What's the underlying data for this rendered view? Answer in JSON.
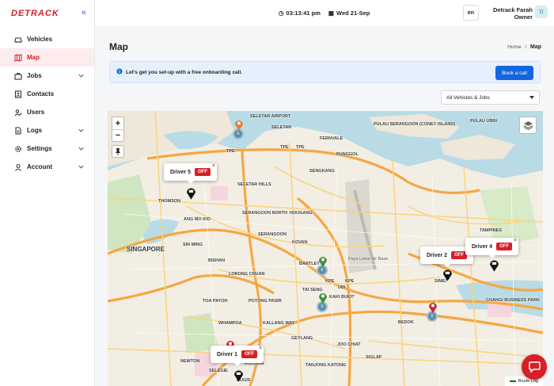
{
  "app": {
    "logo": "DETRACK"
  },
  "sidebar": {
    "items": [
      {
        "label": "Vehicles",
        "icon": "car-icon",
        "active": false,
        "has_submenu": false
      },
      {
        "label": "Map",
        "icon": "map-icon",
        "active": true,
        "has_submenu": false
      },
      {
        "label": "Jobs",
        "icon": "briefcase-icon",
        "active": false,
        "has_submenu": true
      },
      {
        "label": "Contacts",
        "icon": "contacts-icon",
        "active": false,
        "has_submenu": false
      },
      {
        "label": "Users",
        "icon": "users-icon",
        "active": false,
        "has_submenu": false
      },
      {
        "label": "Logs",
        "icon": "log-icon",
        "active": false,
        "has_submenu": true
      },
      {
        "label": "Settings",
        "icon": "gear-icon",
        "active": false,
        "has_submenu": true
      },
      {
        "label": "Account",
        "icon": "account-icon",
        "active": false,
        "has_submenu": true
      }
    ]
  },
  "header": {
    "time": "03:13:41 pm",
    "date": "Wed 21-Sep",
    "language": "en",
    "user_name": "Detrack Farah",
    "user_role": "Owner",
    "avatar_initial": "D"
  },
  "page": {
    "title": "Map",
    "breadcrumb_home": "Home",
    "breadcrumb_sep": "/",
    "breadcrumb_current": "Map"
  },
  "banner": {
    "text": "Let's get you set-up with a free onboarding call.",
    "button": "Book a call"
  },
  "filter": {
    "selected": "All Vehicles & Jobs"
  },
  "map": {
    "zoom_in": "+",
    "zoom_out": "−",
    "route_log": "Route Log",
    "labels": {
      "seletar_airport": "SELETAR AIRPORT",
      "seletar": "SELETAR",
      "fernvale": "FERNVALE",
      "punggol": "PUNGGOL",
      "tpe1": "TPE",
      "tpe2": "TPE",
      "tpe3": "TPE",
      "sengkang": "SENGKANG",
      "seletar_hills": "SELETAR HILLS",
      "thomson": "THOMSON",
      "ang_mo_kio": "ANG MO KIO",
      "serangoon_north": "SERANGOON NORTH",
      "hougang": "HOUGANG",
      "serangoon": "SERANGOON",
      "singapore": "SINGAPORE",
      "sin_ming": "SIN MING",
      "kovan": "KOVAN",
      "bishan": "BISHAN",
      "bartley": "BARTLEY",
      "paya_lebar_air_base": "Paya Lebar Air Base",
      "pulau_serangoon": "PULAU SERANGOON (CONEY ISLAND)",
      "pulau_ubin": "PULAU UBIN",
      "lorong_chuan": "LORONG CHUAN",
      "toa_payoh": "TOA PAYOH",
      "potong_pasir": "POTONG PASIR",
      "tai_seng": "TAI SENG",
      "ubi": "UBI",
      "kaki_bukit": "KAKI BUKIT",
      "kpe1": "KPE",
      "kpe2": "KPE",
      "changi_business_park": "CHANGI BUSINESS PARK",
      "whampoa": "WHAMPOA",
      "kallang_way": "KALLANG WAY",
      "bedok": "BEDOK",
      "geylang": "GEYLANG",
      "joo_chiat": "JOO CHIAT",
      "newton": "NEWTON",
      "rochor": "ROCHOR",
      "bugis": "BUGIS",
      "selegie": "SELEGIE",
      "tanjong_katong": "TANJONG KATONG",
      "siglap": "SIGLAP",
      "tampines": "TAMPINES",
      "simei": "SIMEI"
    },
    "drivers": [
      {
        "name": "Driver 5",
        "status": "OFF"
      },
      {
        "name": "Driver 2",
        "status": "OFF"
      },
      {
        "name": "Driver 4",
        "status": "OFF"
      },
      {
        "name": "Driver 1",
        "status": "OFF"
      }
    ],
    "clusters": [
      "5",
      "5",
      "5",
      "6"
    ],
    "colors": {
      "water": "#b9dbe6",
      "land": "#f3eee4",
      "green": "#cfe6c0",
      "road_major": "#f5a742",
      "road_minor": "#fbd37a"
    }
  },
  "colors": {
    "brand": "#d71f26",
    "accent": "#1366e0",
    "banner_bg": "#e6f0fd"
  }
}
